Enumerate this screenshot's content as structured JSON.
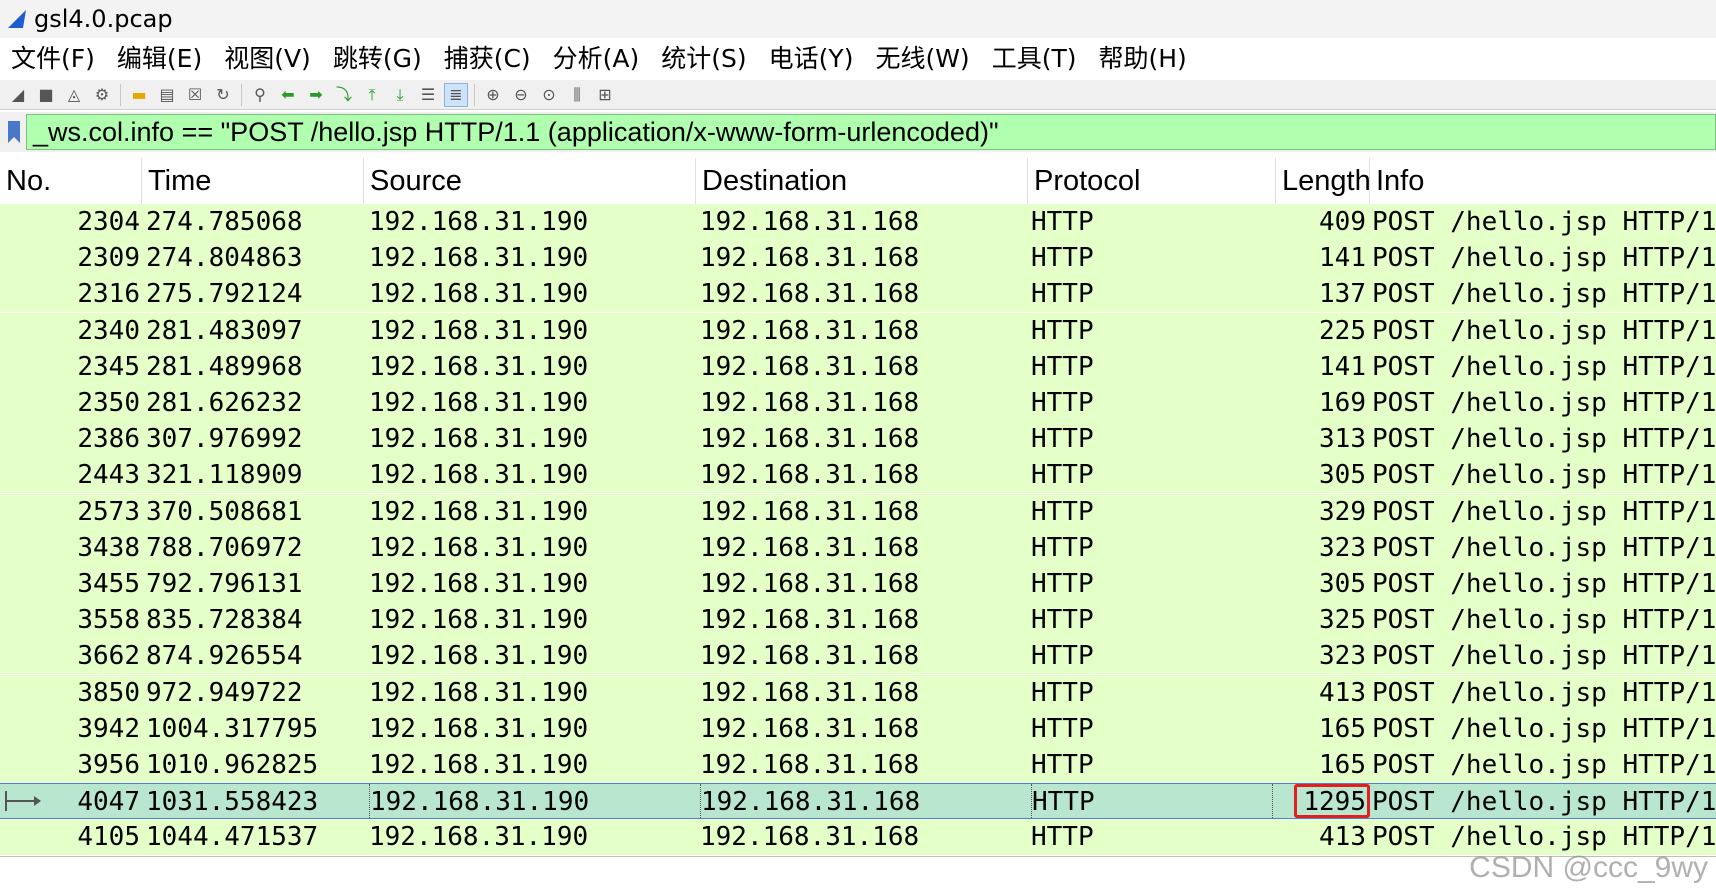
{
  "window": {
    "title": "gsl4.0.pcap",
    "logo_icon": "wireshark-fin-icon"
  },
  "menubar": [
    {
      "label": "文件(F)"
    },
    {
      "label": "编辑(E)"
    },
    {
      "label": "视图(V)"
    },
    {
      "label": "跳转(G)"
    },
    {
      "label": "捕获(C)"
    },
    {
      "label": "分析(A)"
    },
    {
      "label": "统计(S)"
    },
    {
      "label": "电话(Y)"
    },
    {
      "label": "无线(W)"
    },
    {
      "label": "工具(T)"
    },
    {
      "label": "帮助(H)"
    }
  ],
  "toolbar": {
    "icons": [
      "start-capture-icon",
      "stop-capture-icon",
      "restart-capture-icon",
      "capture-options-icon",
      "open-file-icon",
      "save-file-icon",
      "close-file-icon",
      "reload-file-icon",
      "find-packet-icon",
      "go-back-icon",
      "go-forward-icon",
      "go-to-packet-icon",
      "go-first-icon",
      "go-last-icon",
      "auto-scroll-icon",
      "colorize-icon",
      "zoom-in-icon",
      "zoom-out-icon",
      "zoom-normal-icon",
      "resize-columns-icon",
      "layout-icon"
    ]
  },
  "filter": {
    "value": "_ws.col.info == \"POST /hello.jsp HTTP/1.1  (application/x-www-form-urlencoded)\"",
    "bookmark_icon": "bookmark-icon",
    "color": "#afffaf"
  },
  "columns": {
    "no": "No.",
    "time": "Time",
    "source": "Source",
    "destination": "Destination",
    "protocol": "Protocol",
    "length": "Length",
    "info": "Info"
  },
  "rows": [
    {
      "no": "2304",
      "time": "274.785068",
      "source": "192.168.31.190",
      "destination": "192.168.31.168",
      "protocol": "HTTP",
      "length": "409",
      "info": "POST /hello.jsp HTTP/1"
    },
    {
      "no": "2309",
      "time": "274.804863",
      "source": "192.168.31.190",
      "destination": "192.168.31.168",
      "protocol": "HTTP",
      "length": "141",
      "info": "POST /hello.jsp HTTP/1"
    },
    {
      "no": "2316",
      "time": "275.792124",
      "source": "192.168.31.190",
      "destination": "192.168.31.168",
      "protocol": "HTTP",
      "length": "137",
      "info": "POST /hello.jsp HTTP/1"
    },
    {
      "no": "2340",
      "time": "281.483097",
      "source": "192.168.31.190",
      "destination": "192.168.31.168",
      "protocol": "HTTP",
      "length": "225",
      "info": "POST /hello.jsp HTTP/1"
    },
    {
      "no": "2345",
      "time": "281.489968",
      "source": "192.168.31.190",
      "destination": "192.168.31.168",
      "protocol": "HTTP",
      "length": "141",
      "info": "POST /hello.jsp HTTP/1"
    },
    {
      "no": "2350",
      "time": "281.626232",
      "source": "192.168.31.190",
      "destination": "192.168.31.168",
      "protocol": "HTTP",
      "length": "169",
      "info": "POST /hello.jsp HTTP/1"
    },
    {
      "no": "2386",
      "time": "307.976992",
      "source": "192.168.31.190",
      "destination": "192.168.31.168",
      "protocol": "HTTP",
      "length": "313",
      "info": "POST /hello.jsp HTTP/1"
    },
    {
      "no": "2443",
      "time": "321.118909",
      "source": "192.168.31.190",
      "destination": "192.168.31.168",
      "protocol": "HTTP",
      "length": "305",
      "info": "POST /hello.jsp HTTP/1"
    },
    {
      "no": "2573",
      "time": "370.508681",
      "source": "192.168.31.190",
      "destination": "192.168.31.168",
      "protocol": "HTTP",
      "length": "329",
      "info": "POST /hello.jsp HTTP/1"
    },
    {
      "no": "3438",
      "time": "788.706972",
      "source": "192.168.31.190",
      "destination": "192.168.31.168",
      "protocol": "HTTP",
      "length": "323",
      "info": "POST /hello.jsp HTTP/1"
    },
    {
      "no": "3455",
      "time": "792.796131",
      "source": "192.168.31.190",
      "destination": "192.168.31.168",
      "protocol": "HTTP",
      "length": "305",
      "info": "POST /hello.jsp HTTP/1"
    },
    {
      "no": "3558",
      "time": "835.728384",
      "source": "192.168.31.190",
      "destination": "192.168.31.168",
      "protocol": "HTTP",
      "length": "325",
      "info": "POST /hello.jsp HTTP/1"
    },
    {
      "no": "3662",
      "time": "874.926554",
      "source": "192.168.31.190",
      "destination": "192.168.31.168",
      "protocol": "HTTP",
      "length": "323",
      "info": "POST /hello.jsp HTTP/1"
    },
    {
      "no": "3850",
      "time": "972.949722",
      "source": "192.168.31.190",
      "destination": "192.168.31.168",
      "protocol": "HTTP",
      "length": "413",
      "info": "POST /hello.jsp HTTP/1"
    },
    {
      "no": "3942",
      "time": "1004.317795",
      "source": "192.168.31.190",
      "destination": "192.168.31.168",
      "protocol": "HTTP",
      "length": "165",
      "info": "POST /hello.jsp HTTP/1"
    },
    {
      "no": "3956",
      "time": "1010.962825",
      "source": "192.168.31.190",
      "destination": "192.168.31.168",
      "protocol": "HTTP",
      "length": "165",
      "info": "POST /hello.jsp HTTP/1"
    },
    {
      "no": "4047",
      "time": "1031.558423",
      "source": "192.168.31.190",
      "destination": "192.168.31.168",
      "protocol": "HTTP",
      "length": "1295",
      "info": "POST /hello.jsp HTTP/1",
      "selected": true
    },
    {
      "no": "4105",
      "time": "1044.471537",
      "source": "192.168.31.190",
      "destination": "192.168.31.168",
      "protocol": "HTTP",
      "length": "413",
      "info": "POST /hello.jsp HTTP/1"
    }
  ],
  "colors": {
    "row_bg": "#e4ffc7",
    "selected_bg": "#b8e6cf",
    "highlight_border": "#e02020"
  },
  "watermark": "CSDN @ccc_9wy"
}
